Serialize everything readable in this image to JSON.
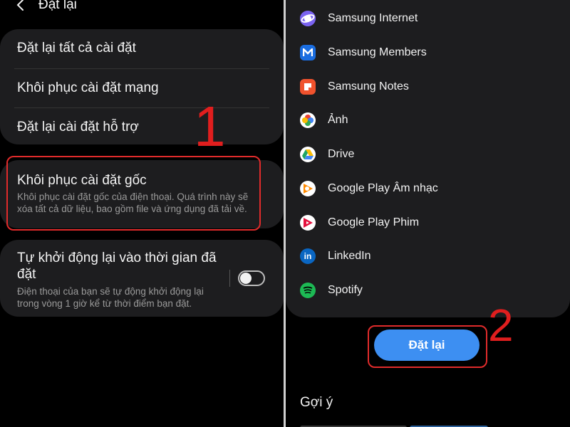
{
  "left": {
    "header": {
      "title": "Đặt lại"
    },
    "items": [
      {
        "label": "Đặt lại tất cả cài đặt"
      },
      {
        "label": "Khôi phục cài đặt mạng"
      },
      {
        "label": "Đặt lại cài đặt hỗ trợ"
      }
    ],
    "factory": {
      "title": "Khôi phục cài đặt gốc",
      "desc_line1": "Khôi phục cài đặt gốc của điện thoại. Quá trình này sẽ",
      "desc_line2": "xóa tất cả dữ liệu, bao gồm file và ứng dụng đã tải về."
    },
    "auto_restart": {
      "title_line1": "Tự khởi động lại vào thời gian đã",
      "title_line2": "đặt",
      "desc_line1": "Điện thoại của bạn sẽ tự động khởi động lại",
      "desc_line2": "trong vòng 1 giờ kể từ thời điểm bạn đặt.",
      "enabled": false
    },
    "annotation": "1"
  },
  "right": {
    "apps": [
      {
        "name": "Samsung Internet",
        "icon": "samsung-internet-icon",
        "color": "#7a63f0"
      },
      {
        "name": "Samsung Members",
        "icon": "samsung-members-icon",
        "color": "#1a6de0"
      },
      {
        "name": "Samsung Notes",
        "icon": "samsung-notes-icon",
        "color": "#f0522d"
      },
      {
        "name": "Ảnh",
        "icon": "google-photos-icon",
        "color": "#fbbc05"
      },
      {
        "name": "Drive",
        "icon": "google-drive-icon",
        "color": "#1fa463"
      },
      {
        "name": "Google Play Âm nhạc",
        "icon": "google-play-music-icon",
        "color": "#ff8a00"
      },
      {
        "name": "Google Play Phim",
        "icon": "google-play-movies-icon",
        "color": "#e5123e"
      },
      {
        "name": "LinkedIn",
        "icon": "linkedin-icon",
        "color": "#0a66c2"
      },
      {
        "name": "Spotify",
        "icon": "spotify-icon",
        "color": "#1db954"
      }
    ],
    "reset_button": "Đặt lại",
    "suggestions_title": "Gợi ý",
    "annotation": "2"
  },
  "colors": {
    "highlight": "#e02b2b",
    "button": "#3d8ff2",
    "card": "#1d1d1f"
  }
}
